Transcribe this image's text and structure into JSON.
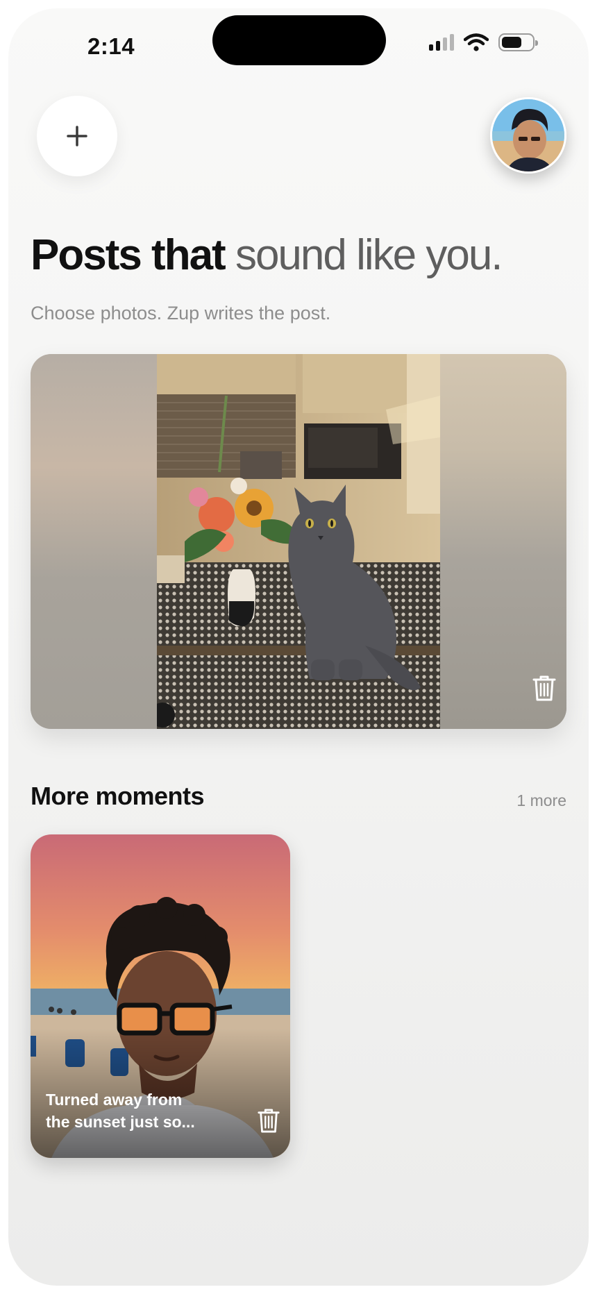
{
  "status_bar": {
    "time": "2:14"
  },
  "header": {
    "add_icon": "plus-icon",
    "avatar_icon": "profile-avatar"
  },
  "headline": {
    "primary": "Posts that ",
    "accent": "sound like you."
  },
  "subtitle": "Choose photos. Zup writes the post.",
  "hero": {
    "photo": "cat-on-kitchen-table",
    "action_icon": "trash-icon"
  },
  "more_moments": {
    "title": "More moments",
    "count": "1 more",
    "items": [
      {
        "caption_line1": "Turned away from",
        "caption_line2": "the sunset just so...",
        "action_icon": "trash-icon"
      }
    ]
  },
  "colors": {
    "accent_text": "#5e5e5e",
    "subtle_text": "#8d8d8d",
    "background": "#f6f6f5"
  }
}
